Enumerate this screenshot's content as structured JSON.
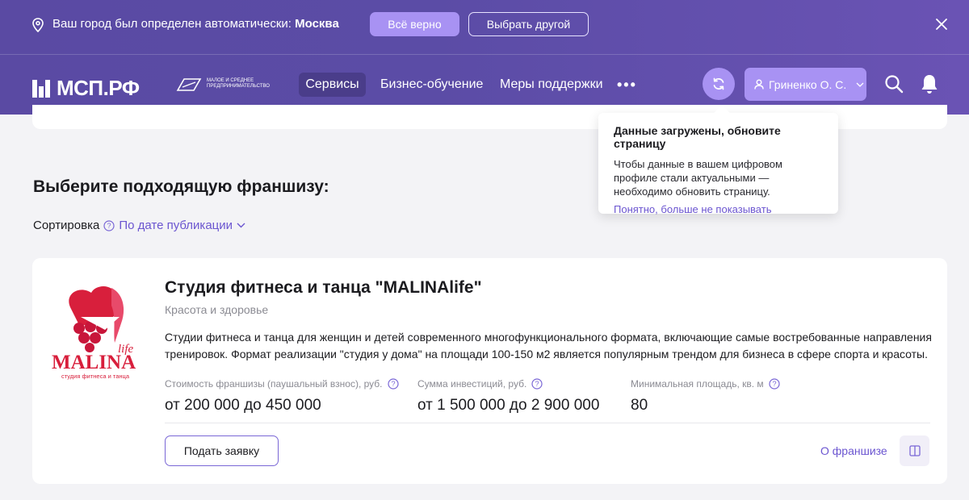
{
  "city_bar": {
    "text_prefix": "Ваш город был определен автоматически:",
    "city": "Москва",
    "confirm_label": "Всё верно",
    "other_label": "Выбрать другой"
  },
  "header": {
    "logo_text": "МСП.РФ",
    "partner_text": "Малое и среднее предпринимательство",
    "nav": [
      "Сервисы",
      "Бизнес-обучение",
      "Меры поддержки",
      "•••"
    ],
    "user_name": "Гриненко О. С."
  },
  "tooltip": {
    "title": "Данные загружены, обновите страницу",
    "body": "Чтобы данные в вашем цифровом профиле стали актуальными — необходимо обновить страницу.",
    "link": "Понятно, больше не показывать"
  },
  "main": {
    "title": "Выберите подходящую франшизу:",
    "sort_label": "Сортировка",
    "sort_value": "По дате публикации"
  },
  "franchise": {
    "title": "Студия фитнеса и танца \"MALINAlife\"",
    "category": "Красота и здоровье",
    "description": "Студии фитнеса и танца для женщин и детей современного многофункционального формата, включающие самые востребованные направления тренировок. Формат реализации \"студия у дома\" на площади 100-150 м2 является популярным трендом для бизнеса в сфере спорта и красоты.",
    "metrics": [
      {
        "label": "Стоимость франшизы (паушальный взнос), руб.",
        "value": "от 200 000 до 450 000"
      },
      {
        "label": "Сумма инвестиций, руб.",
        "value": "от 1 500 000 до 2 900 000"
      },
      {
        "label": "Минимальная площадь, кв. м",
        "value": "80"
      }
    ],
    "apply_label": "Подать заявку",
    "about_label": "О франшизе",
    "logo_word": "MALINA",
    "logo_sup": "life",
    "logo_caption": "студия фитнеса и танца"
  },
  "colors": {
    "header_start": "#5a4aa3",
    "header_end": "#6a53b4",
    "accent": "#a892f3",
    "link": "#6b55d0",
    "logo_red": "#d81f3c"
  }
}
